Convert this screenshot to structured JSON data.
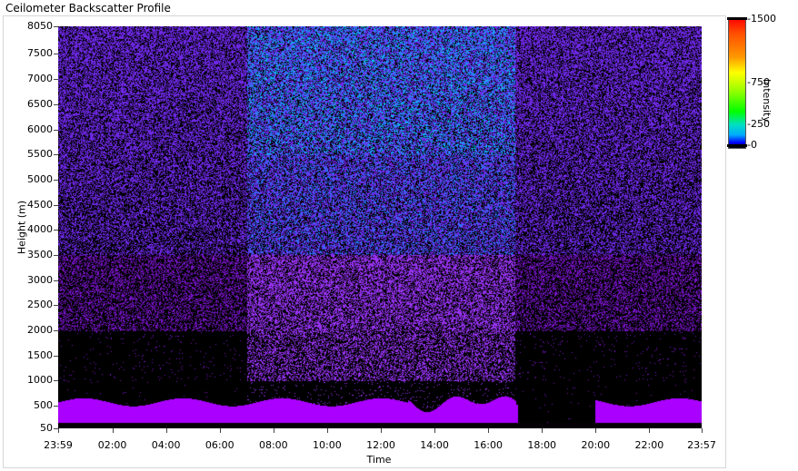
{
  "window": {
    "title": "Ceilometer Backscatter Profile"
  },
  "chart_data": {
    "type": "heatmap",
    "title": "Ceilometer Backscatter Profile",
    "xlabel": "Time",
    "ylabel": "Height (m)",
    "x_ticks": [
      "23:59",
      "02:00",
      "04:00",
      "06:00",
      "08:00",
      "10:00",
      "12:00",
      "14:00",
      "16:00",
      "18:00",
      "20:00",
      "22:00",
      "23:57"
    ],
    "x_tick_hours": [
      -0.0167,
      2,
      4,
      6,
      8,
      10,
      12,
      14,
      16,
      18,
      20,
      22,
      23.95
    ],
    "y_ticks": [
      50,
      500,
      1000,
      1500,
      2000,
      2500,
      3000,
      3500,
      4000,
      4500,
      5000,
      5500,
      6000,
      6500,
      7000,
      7500,
      8050
    ],
    "ylim": [
      50,
      8050
    ],
    "colorbar": {
      "label": "Intensity",
      "ticks": [
        1500,
        750,
        250,
        0
      ],
      "range": [
        0,
        1500
      ],
      "colors": [
        "#000000",
        "#0000ff",
        "#00aaff",
        "#00ff00",
        "#ffff00",
        "#ff9800",
        "#ff0000"
      ]
    },
    "description_layers": [
      {
        "name": "low-layer",
        "start_hour": 0,
        "end_hour": 24,
        "bottom_m": 150,
        "top_m": 600,
        "intensity": 600
      },
      {
        "name": "sparse-upper",
        "start_hour": 0,
        "end_hour": 24,
        "bottom_m": 2000,
        "top_m": 8050,
        "intensity": 120
      },
      {
        "name": "daytime-plume",
        "start_hour": 7,
        "end_hour": 17,
        "bottom_m": 1000,
        "top_m": 8050,
        "intensity": 260
      }
    ]
  }
}
